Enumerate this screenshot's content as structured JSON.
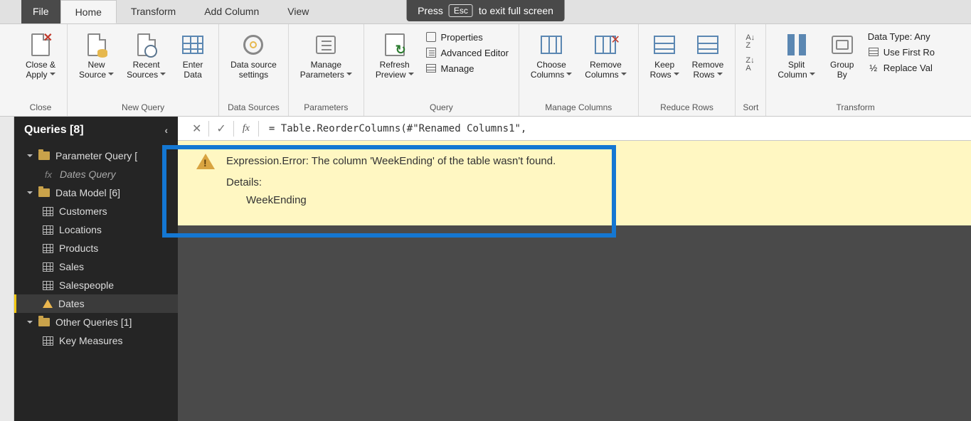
{
  "overlay": {
    "press": "Press",
    "esc": "Esc",
    "rest": "to exit full screen"
  },
  "tabs": {
    "file": "File",
    "home": "Home",
    "transform": "Transform",
    "add_column": "Add Column",
    "view": "View"
  },
  "ribbon": {
    "close": {
      "close_apply": "Close &\nApply",
      "group": "Close"
    },
    "new_query": {
      "new_source": "New\nSource",
      "recent_sources": "Recent\nSources",
      "enter_data": "Enter\nData",
      "group": "New Query"
    },
    "data_sources": {
      "settings": "Data source\nsettings",
      "group": "Data Sources"
    },
    "parameters": {
      "manage": "Manage\nParameters",
      "group": "Parameters"
    },
    "query": {
      "refresh": "Refresh\nPreview",
      "properties": "Properties",
      "advanced": "Advanced Editor",
      "manage": "Manage",
      "group": "Query"
    },
    "manage_columns": {
      "choose": "Choose\nColumns",
      "remove": "Remove\nColumns",
      "group": "Manage Columns"
    },
    "reduce_rows": {
      "keep": "Keep\nRows",
      "remove": "Remove\nRows",
      "group": "Reduce Rows"
    },
    "sort": {
      "group": "Sort"
    },
    "transform_grp": {
      "split": "Split\nColumn",
      "groupby": "Group\nBy",
      "datatype": "Data Type: Any",
      "first_row": "Use First Ro",
      "replace": "Replace Val",
      "group": "Transform"
    }
  },
  "sidebar": {
    "title": "Queries [8]",
    "folders": {
      "param": "Parameter Query [",
      "dates_q": "Dates Query",
      "data_model": "Data Model [6]",
      "other": "Other Queries [1]"
    },
    "tables": {
      "customers": "Customers",
      "locations": "Locations",
      "products": "Products",
      "sales": "Sales",
      "salespeople": "Salespeople",
      "dates": "Dates",
      "keymeasures": "Key Measures"
    }
  },
  "formula": {
    "expr": "= Table.ReorderColumns(#\"Renamed Columns1\","
  },
  "error": {
    "line1": "Expression.Error: The column 'WeekEnding' of the table wasn't found.",
    "details_label": "Details:",
    "details_value": "WeekEnding"
  }
}
